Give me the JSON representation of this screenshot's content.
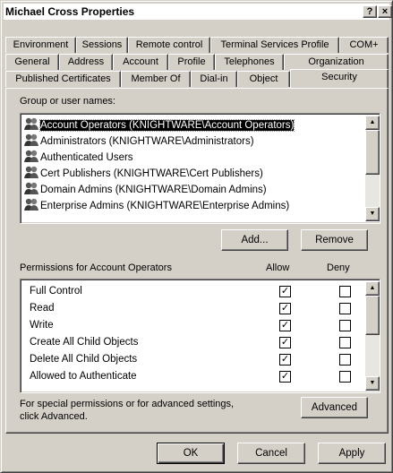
{
  "window": {
    "title": "Michael Cross Properties",
    "help_glyph": "?",
    "close_glyph": "×"
  },
  "tabs": {
    "row1": [
      "Environment",
      "Sessions",
      "Remote control",
      "Terminal Services Profile",
      "COM+"
    ],
    "row2": [
      "General",
      "Address",
      "Account",
      "Profile",
      "Telephones",
      "Organization"
    ],
    "row3": [
      "Published Certificates",
      "Member Of",
      "Dial-in",
      "Object",
      "Security"
    ],
    "active": "Security"
  },
  "groups": {
    "label": "Group or user names:",
    "items": [
      "Account Operators (KNIGHTWARE\\Account Operators)",
      "Administrators (KNIGHTWARE\\Administrators)",
      "Authenticated Users",
      "Cert Publishers (KNIGHTWARE\\Cert Publishers)",
      "Domain Admins (KNIGHTWARE\\Domain Admins)",
      "Enterprise Admins (KNIGHTWARE\\Enterprise Admins)"
    ],
    "selected_index": 0,
    "add_label": "Add...",
    "remove_label": "Remove"
  },
  "permissions": {
    "label": "Permissions for Account Operators",
    "allow_header": "Allow",
    "deny_header": "Deny",
    "rows": [
      {
        "name": "Full Control",
        "allow": true,
        "deny": false
      },
      {
        "name": "Read",
        "allow": true,
        "deny": false
      },
      {
        "name": "Write",
        "allow": true,
        "deny": false
      },
      {
        "name": "Create All Child Objects",
        "allow": true,
        "deny": false
      },
      {
        "name": "Delete All Child Objects",
        "allow": true,
        "deny": false
      },
      {
        "name": "Allowed to Authenticate",
        "allow": true,
        "deny": false
      }
    ]
  },
  "advanced": {
    "text_line1": "For special permissions or for advanced settings,",
    "text_line2": "click Advanced.",
    "button_label": "Advanced"
  },
  "footer": {
    "ok_label": "OK",
    "cancel_label": "Cancel",
    "apply_label": "Apply"
  },
  "colors": {
    "face": "#d4d0c8",
    "selection": "#000000",
    "window_bg": "#ffffff"
  }
}
